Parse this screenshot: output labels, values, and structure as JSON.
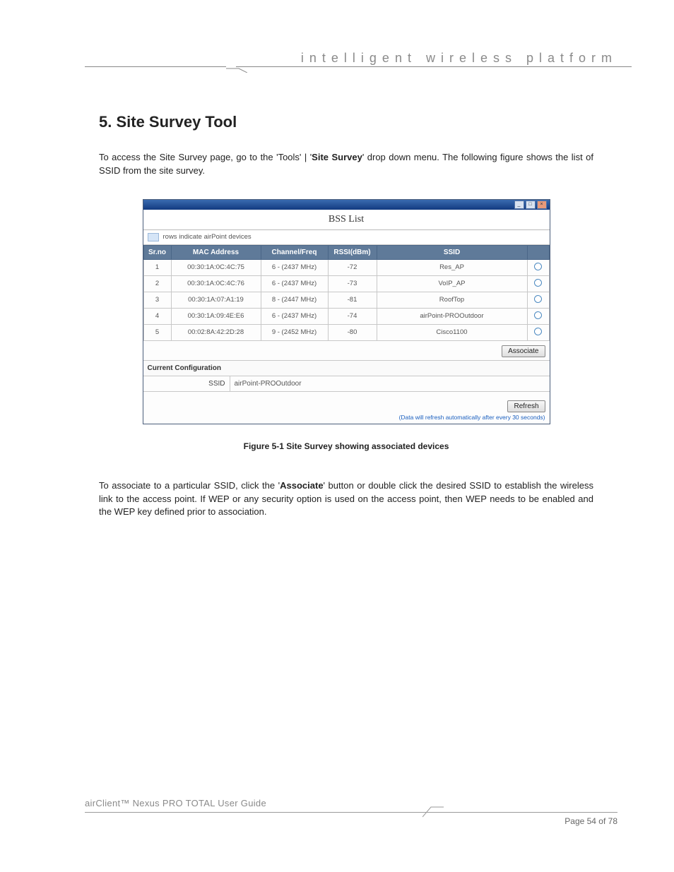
{
  "header": {
    "tagline": "intelligent wireless platform"
  },
  "section": {
    "title": "5. Site Survey Tool",
    "intro_pre": "To access the Site Survey page, go to the 'Tools' | '",
    "intro_bold": "Site Survey",
    "intro_post": "' drop down menu. The following figure shows the list of SSID from the site survey."
  },
  "window": {
    "bss_title": "BSS List",
    "legend": "rows indicate airPoint devices",
    "columns": {
      "srno": "Sr.no",
      "mac": "MAC Address",
      "chan": "Channel/Freq",
      "rssi": "RSSI(dBm)",
      "ssid": "SSID"
    },
    "rows": [
      {
        "srno": "1",
        "mac": "00:30:1A:0C:4C:75",
        "chan": "6 - (2437 MHz)",
        "rssi": "-72",
        "ssid": "Res_AP"
      },
      {
        "srno": "2",
        "mac": "00:30:1A:0C:4C:76",
        "chan": "6 - (2437 MHz)",
        "rssi": "-73",
        "ssid": "VoIP_AP"
      },
      {
        "srno": "3",
        "mac": "00:30:1A:07:A1:19",
        "chan": "8 - (2447 MHz)",
        "rssi": "-81",
        "ssid": "RoofTop"
      },
      {
        "srno": "4",
        "mac": "00:30:1A:09:4E:E6",
        "chan": "6 - (2437 MHz)",
        "rssi": "-74",
        "ssid": "airPoint-PROOutdoor"
      },
      {
        "srno": "5",
        "mac": "00:02:8A:42:2D:28",
        "chan": "9 - (2452 MHz)",
        "rssi": "-80",
        "ssid": "Cisco1100"
      }
    ],
    "associate_btn": "Associate",
    "conf_header": "Current Configuration",
    "conf_ssid_label": "SSID",
    "conf_ssid_value": "airPoint-PROOutdoor",
    "refresh_btn": "Refresh",
    "refresh_note": "(Data will refresh automatically after every 30 seconds)"
  },
  "caption": "Figure 5-1 Site Survey showing associated devices",
  "outro": {
    "pre": "To associate to a particular SSID, click the '",
    "bold": "Associate",
    "post": "' button or double click the desired SSID to establish the wireless link to the access point. If WEP or any security option is used on the access point, then WEP needs to be enabled and the WEP key defined prior to association."
  },
  "footer": {
    "left": "airClient™ Nexus PRO TOTAL User Guide",
    "right": "Page 54 of 78"
  }
}
